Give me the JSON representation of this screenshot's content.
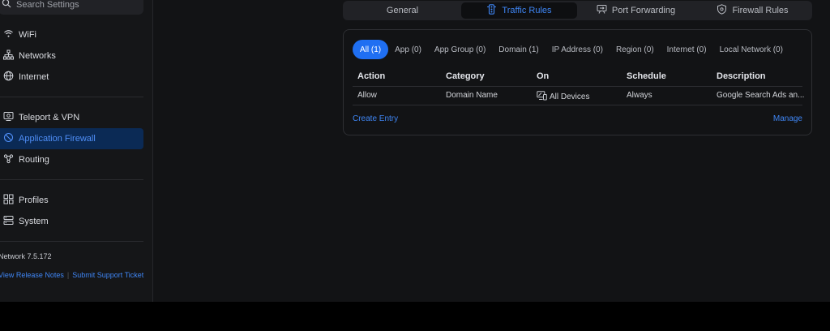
{
  "search": {
    "placeholder": "Search Settings"
  },
  "sidebar": {
    "items": [
      {
        "label": "WiFi",
        "icon": "wifi-icon"
      },
      {
        "label": "Networks",
        "icon": "networks-icon"
      },
      {
        "label": "Internet",
        "icon": "globe-icon"
      },
      {
        "label": "Teleport & VPN",
        "icon": "teleport-icon"
      },
      {
        "label": "Application Firewall",
        "icon": "shield-icon",
        "active": true
      },
      {
        "label": "Routing",
        "icon": "routing-icon"
      },
      {
        "label": "Profiles",
        "icon": "profiles-icon"
      },
      {
        "label": "System",
        "icon": "system-icon"
      }
    ],
    "version": "Network 7.5.172",
    "links": {
      "release_notes": "View Release Notes",
      "separator": "|",
      "support": "Submit Support Ticket"
    }
  },
  "tabs": [
    {
      "label": "General",
      "icon": ""
    },
    {
      "label": "Traffic Rules",
      "icon": "traffic-light-icon",
      "active": true
    },
    {
      "label": "Port Forwarding",
      "icon": "port-forwarding-icon"
    },
    {
      "label": "Firewall Rules",
      "icon": "shield-icon"
    }
  ],
  "filters": [
    {
      "label": "All (1)",
      "active": true
    },
    {
      "label": "App (0)"
    },
    {
      "label": "App Group (0)"
    },
    {
      "label": "Domain (1)"
    },
    {
      "label": "IP Address (0)"
    },
    {
      "label": "Region (0)"
    },
    {
      "label": "Internet (0)"
    },
    {
      "label": "Local Network (0)"
    }
  ],
  "table": {
    "columns": [
      "Action",
      "Category",
      "On",
      "Schedule",
      "Description"
    ],
    "rows": [
      {
        "action": "Allow",
        "category": "Domain Name",
        "on": "All Devices",
        "schedule": "Always",
        "description": "Google Search Ads an..."
      }
    ]
  },
  "actions": {
    "create": "Create Entry",
    "manage": "Manage"
  },
  "colors": {
    "accent": "#3f86f5",
    "active_chip": "#1f6ff2",
    "active_nav_bg": "#0b2a55",
    "background": "#121315",
    "sidebar": "#151618"
  }
}
